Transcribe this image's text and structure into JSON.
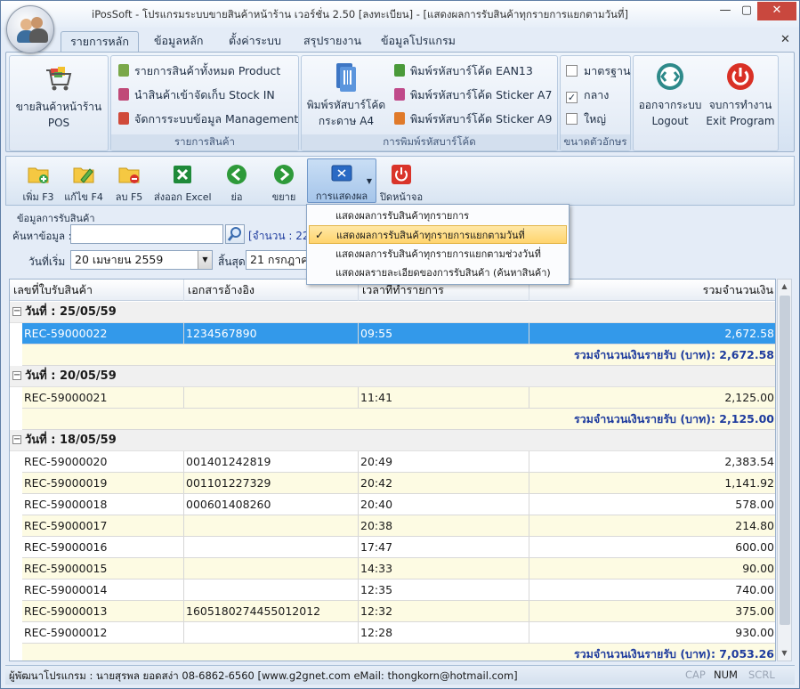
{
  "window": {
    "title": "iPosSoft - โปรแกรมระบบขายสินค้าหน้าร้าน เวอร์ชั่น 2.50 [ลงทะเบียน] - [แสดงผลการรับสินค้าทุกรายการแยกตามวันที่]",
    "min": "—",
    "max": "▢",
    "close": "✕",
    "tab_close": "✕"
  },
  "tabs": [
    "รายการหลัก",
    "ข้อมูลหลัก",
    "ตั้งค่าระบบ",
    "สรุปรายงาน",
    "ข้อมูลโปรแกรม"
  ],
  "ribbon": {
    "pos": {
      "line1": "ขายสินค้าหน้าร้าน",
      "line2": "POS"
    },
    "products_group": "รายการสินค้า",
    "all_products": "รายการสินค้าทั้งหมด Product",
    "stock_in": "นำสินค้าเข้าจัดเก็บ Stock IN",
    "management": "จัดการระบบข้อมูล Management",
    "print_a4": {
      "line1": "พิมพ์รหัสบาร์โค้ด",
      "line2": "กระดาษ A4"
    },
    "ean13": "พิมพ์รหัสบาร์โค้ด EAN13",
    "sticker_a7": "พิมพ์รหัสบาร์โค้ด Sticker A7",
    "sticker_a9": "พิมพ์รหัสบาร์โค้ด Sticker A9",
    "barcode_group": "การพิมพ์รหัสบาร์โค้ด",
    "font_group": "ขนาดตัวอักษร",
    "font_standard": "มาตรฐาน",
    "font_medium": "กลาง",
    "font_large": "ใหญ่",
    "font_medium_checked": "✓",
    "logout": {
      "line1": "ออกจากระบบ",
      "line2": "Logout"
    },
    "exit": {
      "line1": "จบการทำงาน",
      "line2": "Exit Program"
    }
  },
  "toolbar": {
    "add": "เพิ่ม F3",
    "edit": "แก้ไข F4",
    "delete": "ลบ F5",
    "export": "ส่งออก Excel",
    "collapse": "ย่อ",
    "expand": "ขยาย",
    "display": "การแสดงผล",
    "close_screen": "ปิดหน้าจอ"
  },
  "filter": {
    "section": "ข้อมูลการรับสินค้า",
    "search_label": "ค้นหาข้อมูล :",
    "search_value": "",
    "count_text": "[จำนวน : 22",
    "start_label": "วันที่เริ่ม",
    "start_value": "20  เมษายน    2559",
    "end_label": "สิ้นสุด",
    "end_value": "21  กรกฎาค"
  },
  "dropdown": {
    "items": [
      "แสดงผลการรับสินค้าทุกรายการ",
      "แสดงผลการรับสินค้าทุกรายการแยกตามวันที่",
      "แสดงผลการรับสินค้าทุกรายการแยกตามช่วงวันที่",
      "แสดงผลรายละเอียดของการรับสินค้า (ค้นหาสินค้า)"
    ],
    "selected_index": 1,
    "check": "✓"
  },
  "grid": {
    "columns": [
      "เลขที่ใบรับสินค้า",
      "เอกสารอ้างอิง",
      "เวลาที่ทำรายการ",
      "รวมจำนวนเงิน"
    ],
    "groups": [
      {
        "label": "วันที่ : 25/05/59",
        "rows": [
          [
            "REC-59000022",
            "1234567890",
            "09:55",
            "2,672.58"
          ]
        ],
        "summary": "รวมจำนวนเงินรายรับ (บาท): 2,672.58"
      },
      {
        "label": "วันที่ : 20/05/59",
        "rows": [
          [
            "REC-59000021",
            "",
            "11:41",
            "2,125.00"
          ]
        ],
        "summary": "รวมจำนวนเงินรายรับ (บาท): 2,125.00"
      },
      {
        "label": "วันที่ : 18/05/59",
        "rows": [
          [
            "REC-59000020",
            "001401242819",
            "20:49",
            "2,383.54"
          ],
          [
            "REC-59000019",
            "001101227329",
            "20:42",
            "1,141.92"
          ],
          [
            "REC-59000018",
            "000601408260",
            "20:40",
            "578.00"
          ],
          [
            "REC-59000017",
            "",
            "20:38",
            "214.80"
          ],
          [
            "REC-59000016",
            "",
            "17:47",
            "600.00"
          ],
          [
            "REC-59000015",
            "",
            "14:33",
            "90.00"
          ],
          [
            "REC-59000014",
            "",
            "12:35",
            "740.00"
          ],
          [
            "REC-59000013",
            "1605180274455012012",
            "12:32",
            "375.00"
          ],
          [
            "REC-59000012",
            "",
            "12:28",
            "930.00"
          ]
        ],
        "summary": "รวมจำนวนเงินรายรับ (บาท): 7,053.26"
      }
    ],
    "toggle": "−"
  },
  "status": {
    "developer": "ผู้พัฒนาโปรแกรม : นายสุรพล ยอดสง่า 08-6862-6560 [www.g2gnet.com  eMail: thongkorn@hotmail.com]",
    "cap": "CAP",
    "num": "NUM",
    "scrl": "SCRL"
  },
  "colors": {
    "accent": "#3399ea",
    "summary_text": "#1f3c9e",
    "row_alt": "#fdfbe3"
  }
}
